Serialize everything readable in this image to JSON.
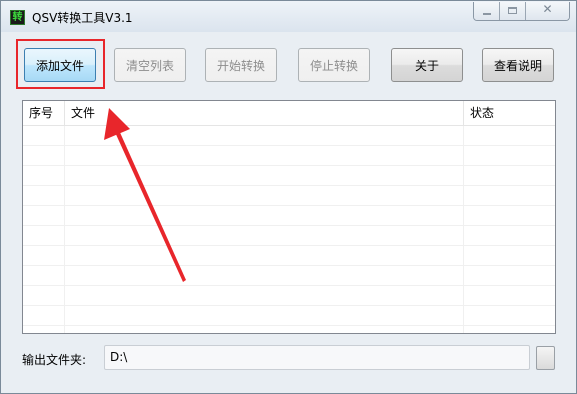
{
  "window": {
    "title": "QSV转换工具V3.1",
    "icon": "qsv-app-icon",
    "controls": [
      "minimize",
      "maximize",
      "close"
    ]
  },
  "toolbar": {
    "add_file": "添加文件",
    "clear_list": "清空列表",
    "start_convert": "开始转换",
    "stop_convert": "停止转换",
    "about": "关于",
    "view_help": "查看说明"
  },
  "file_list": {
    "columns": [
      "序号",
      "文件",
      "状态"
    ],
    "rows": []
  },
  "output": {
    "label": "输出文件夹:",
    "path": "D:\\"
  },
  "annotation": {
    "color": "#e8262b"
  }
}
